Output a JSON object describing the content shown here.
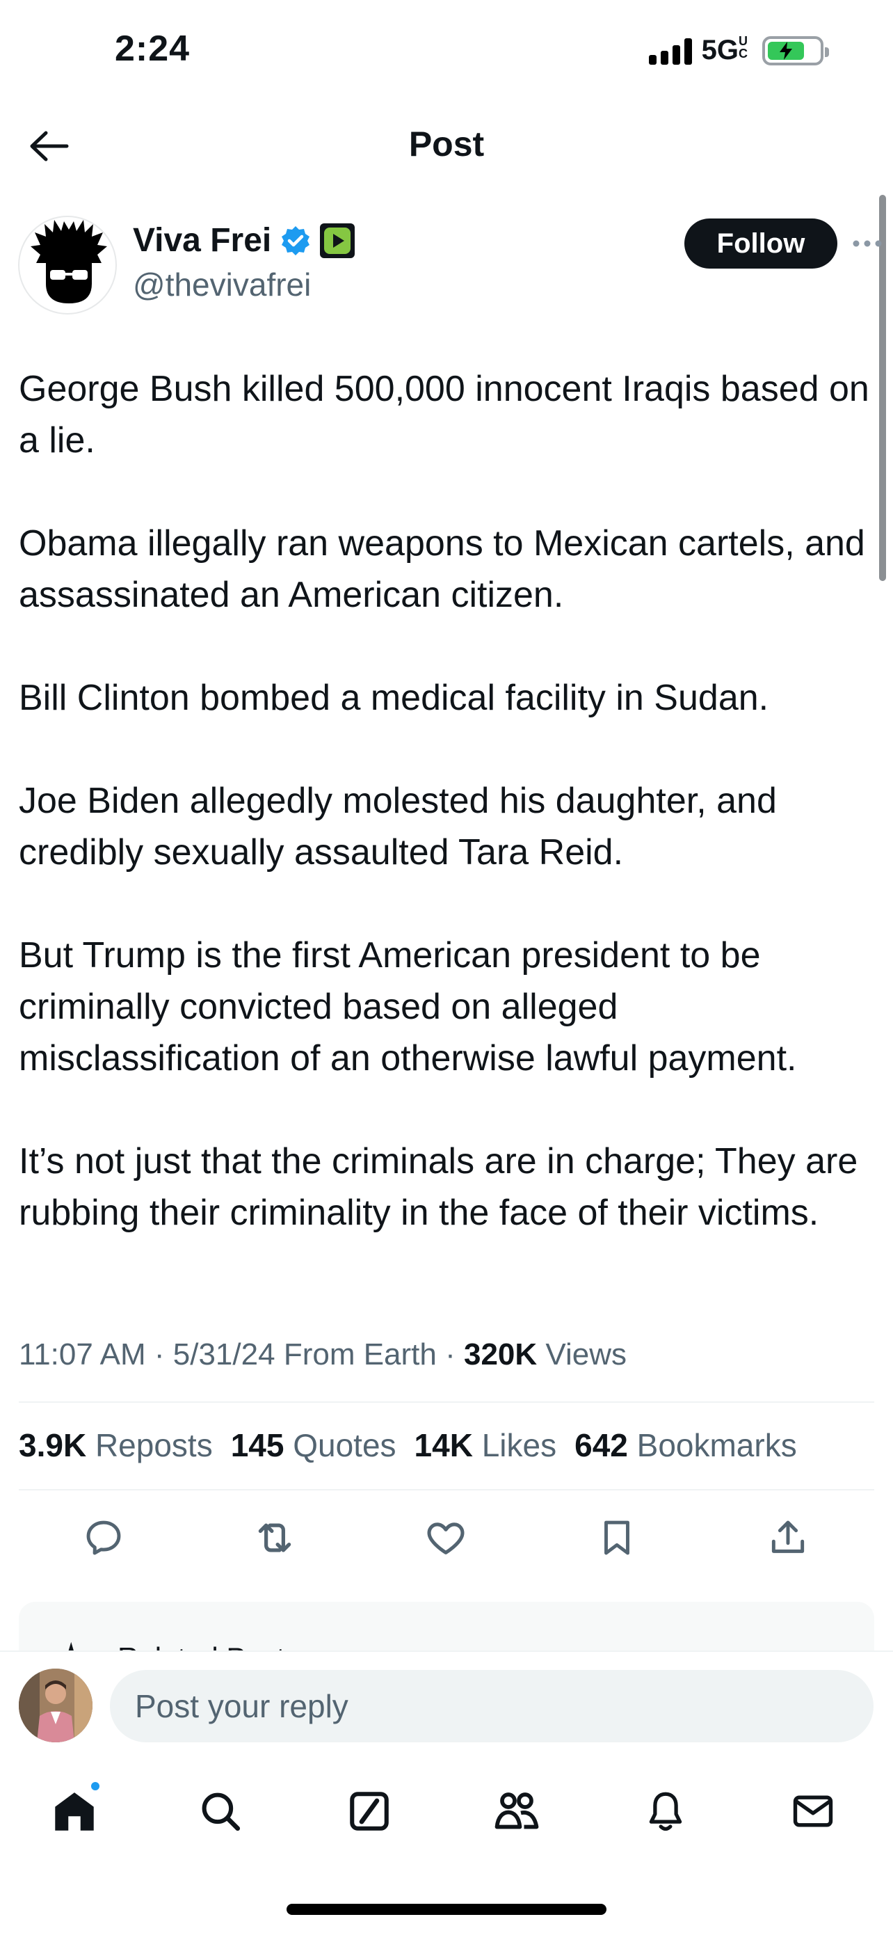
{
  "status_bar": {
    "time": "2:24",
    "network": "5G",
    "network_suffix": "UC"
  },
  "header": {
    "title": "Post"
  },
  "author": {
    "name": "Viva Frei",
    "handle": "@thevivafrei",
    "follow_label": "Follow"
  },
  "post": {
    "paragraphs": [
      "George Bush killed 500,000 innocent Iraqis based on a lie.",
      "Obama illegally ran weapons to Mexican cartels, and assassinated an American citizen.",
      "Bill Clinton bombed a medical facility in Sudan.",
      "Joe Biden allegedly molested his daughter, and credibly sexually assaulted Tara Reid.",
      "But Trump is the first American president to be criminally convicted based on alleged misclassification of an otherwise lawful payment.",
      "It’s not just that the criminals are in charge; They are rubbing their criminality in the face of their victims."
    ]
  },
  "meta": {
    "time": "11:07 AM",
    "date": "5/31/24",
    "source": "From Earth",
    "views_count": "320K",
    "views_label": "Views"
  },
  "stats": {
    "reposts_count": "3.9K",
    "reposts_label": "Reposts",
    "quotes_count": "145",
    "quotes_label": "Quotes",
    "likes_count": "14K",
    "likes_label": "Likes",
    "bookmarks_count": "642",
    "bookmarks_label": "Bookmarks"
  },
  "related": {
    "label": "Related Posts"
  },
  "reply": {
    "placeholder": "Post your reply"
  },
  "colors": {
    "verified": "#1d9bf0",
    "rumble_badge": "#85c742",
    "accent": "#1d9bf0",
    "text_secondary": "#536471"
  }
}
